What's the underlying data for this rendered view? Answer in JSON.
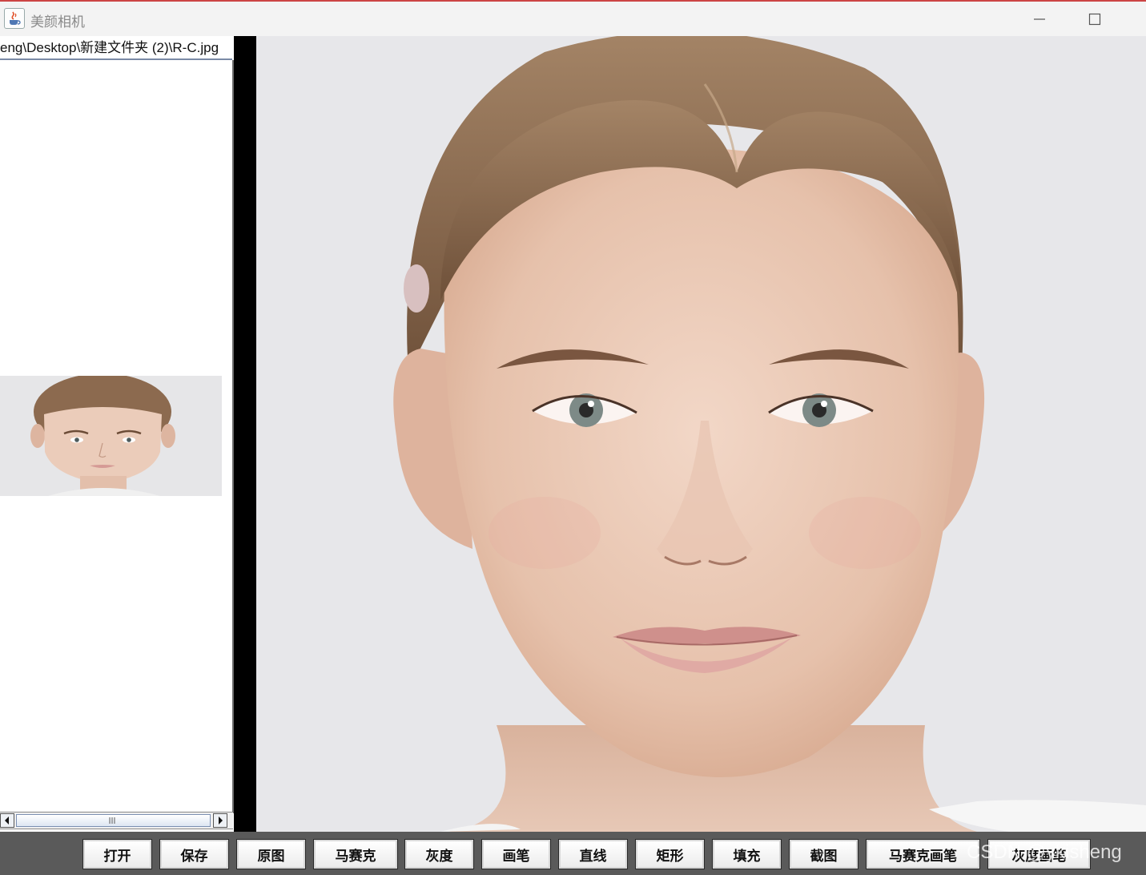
{
  "window": {
    "title": "美颜相机",
    "minimize_symbol": "—",
    "maximize_symbol": "☐"
  },
  "left_panel": {
    "path": "eng\\Desktop\\新建文件夹 (2)\\R-C.jpg",
    "thumbnail_label": "R-C.jpg"
  },
  "toolbar": {
    "buttons": [
      {
        "label": "打开"
      },
      {
        "label": "保存"
      },
      {
        "label": "原图"
      },
      {
        "label": "马赛克"
      },
      {
        "label": "灰度"
      },
      {
        "label": "画笔"
      },
      {
        "label": "直线"
      },
      {
        "label": "矩形"
      },
      {
        "label": "填充"
      },
      {
        "label": "截图"
      },
      {
        "label": "马赛克画笔"
      },
      {
        "label": "灰度画笔"
      }
    ]
  },
  "watermark": "CSDN @ykisheng",
  "icons": {
    "app": "java-cup-icon",
    "minimize": "minimize-icon",
    "maximize": "maximize-icon",
    "scroll_left": "arrow-left-icon",
    "scroll_right": "arrow-right-icon",
    "scroll_grip": "grip-icon"
  },
  "colors": {
    "toolbar_bg": "#5a5a5a",
    "divider": "#000000",
    "titlebar_bg": "#f3f3f3",
    "canvas_bg": "#e7e7ea",
    "skin": "#e6c3b0",
    "hair": "#8c6a4f"
  }
}
